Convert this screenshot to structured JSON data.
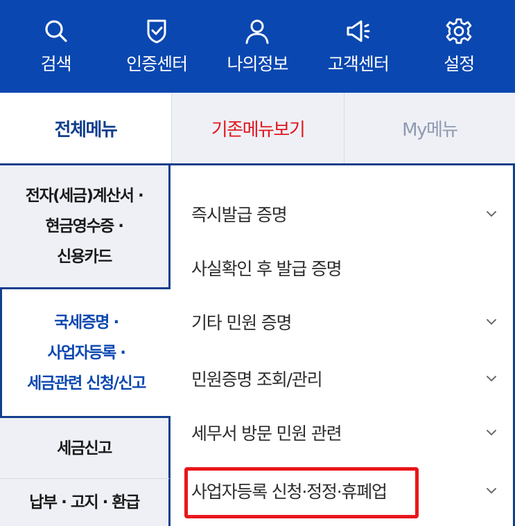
{
  "topbar": {
    "bg_color": "#0a47b0",
    "items": [
      {
        "label": "검색",
        "icon": "search-icon"
      },
      {
        "label": "인증센터",
        "icon": "shield-check-icon"
      },
      {
        "label": "나의정보",
        "icon": "user-icon"
      },
      {
        "label": "고객센터",
        "icon": "megaphone-icon"
      },
      {
        "label": "설정",
        "icon": "gear-icon"
      }
    ]
  },
  "tabs": {
    "all": "전체메뉴",
    "old": "기존메뉴보기",
    "my": "My메뉴",
    "accent_color": "#123f8c",
    "old_color": "#e0161e"
  },
  "sidebar": {
    "items": [
      {
        "lines": [
          "전자(세금)계산서 ·",
          "현금영수증 ·",
          "신용카드"
        ]
      },
      {
        "lines": [
          "국세증명 ·",
          "사업자등록 ·",
          "세금관련 신청/신고"
        ],
        "selected": true
      },
      {
        "lines": [
          "세금신고"
        ]
      },
      {
        "lines": [
          "납부 · 고지 · 환급"
        ]
      }
    ]
  },
  "submenu": {
    "items": [
      {
        "label": "즉시발급 증명",
        "has_chevron": true
      },
      {
        "label": "사실확인 후 발급 증명",
        "has_chevron": false
      },
      {
        "label": "기타 민원 증명",
        "has_chevron": true
      },
      {
        "label": "민원증명 조회/관리",
        "has_chevron": true
      },
      {
        "label": "세무서 방문 민원 관련",
        "has_chevron": true
      },
      {
        "label": "사업자등록 신청·정정·휴폐업",
        "has_chevron": true,
        "highlighted": true
      }
    ],
    "highlight_color": "#e8161c"
  }
}
